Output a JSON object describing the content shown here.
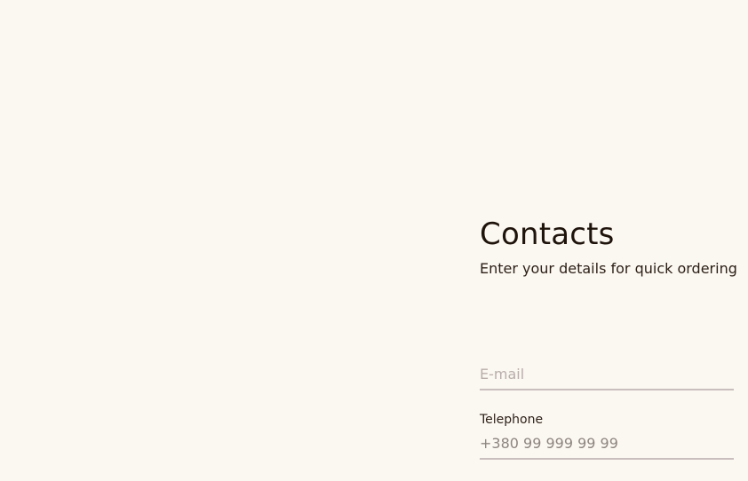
{
  "contacts": {
    "title": "Contacts",
    "subtitle": "Enter your details for quick ordering"
  },
  "form": {
    "email": {
      "label": "",
      "value": "",
      "placeholder": "E-mail"
    },
    "telephone": {
      "label": "Telephone",
      "value": "",
      "placeholder": "+380 99 999 99 99"
    }
  },
  "colors": {
    "background": "#fbf7f1",
    "text": "#1f140c",
    "underline": "#c9bfbe"
  }
}
